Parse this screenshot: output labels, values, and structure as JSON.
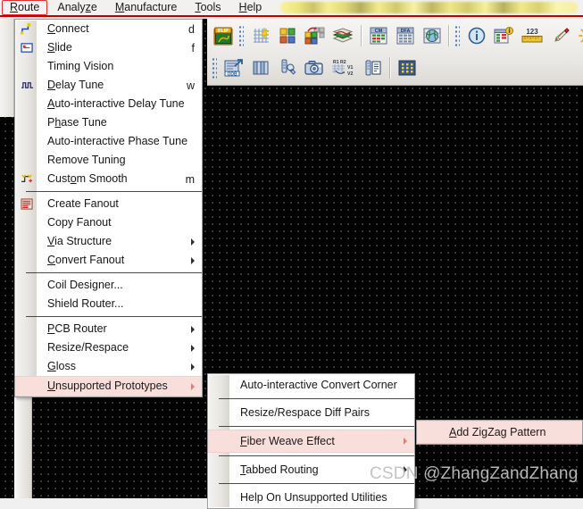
{
  "app": {
    "canvas_bg": "#000000",
    "accent_red": "#c00000",
    "highlight_pink": "#f9dfdc"
  },
  "menubar": {
    "items": [
      {
        "label": "Route",
        "mnemonic": "R",
        "selected": true
      },
      {
        "label": "Analyze",
        "mnemonic": "z",
        "selected": false
      },
      {
        "label": "Manufacture",
        "mnemonic": "M",
        "selected": false
      },
      {
        "label": "Tools",
        "mnemonic": "T",
        "selected": false
      },
      {
        "label": "Help",
        "mnemonic": "H",
        "selected": false
      }
    ],
    "censored_region": "redacted-yellow-highlight"
  },
  "toolbar": {
    "row1": [
      {
        "name": "flip-design-icon",
        "label": "FLIP"
      },
      {
        "name": "grid-sparkle-icon",
        "label": ""
      },
      {
        "name": "color-squares-icon",
        "label": ""
      },
      {
        "name": "color-squares-move-icon",
        "label": ""
      },
      {
        "name": "stackup-layers-icon",
        "label": ""
      },
      {
        "name": "cm-table-icon",
        "label": "CM"
      },
      {
        "name": "dfa-table-icon",
        "label": "DFA"
      },
      {
        "name": "globe-table-icon",
        "label": ""
      },
      {
        "name": "info-icon",
        "label": "i"
      },
      {
        "name": "table-info-badge-icon",
        "label": ""
      },
      {
        "name": "measure-ruler-icon",
        "label": "123"
      },
      {
        "name": "highlighter-pencil-icon",
        "label": ""
      },
      {
        "name": "sun-brightness-icon",
        "label": ""
      }
    ],
    "row2": [
      {
        "name": "odb-export-icon",
        "label": "ODB"
      },
      {
        "name": "layer-stack-icon",
        "label": ""
      },
      {
        "name": "wrench-tool-icon",
        "label": ""
      },
      {
        "name": "camera-snapshot-icon",
        "label": ""
      },
      {
        "name": "via-rule-icon",
        "label": "R1 R2 V1 V2"
      },
      {
        "name": "report-document-icon",
        "label": ""
      },
      {
        "name": "dot-matrix-icon",
        "label": ""
      }
    ]
  },
  "route_menu": {
    "items": [
      {
        "label": "Connect",
        "mnemonic": "C",
        "shortcut": "d",
        "icon": "connect-trace-icon",
        "arrow": false,
        "highlight": false
      },
      {
        "label": "Slide",
        "mnemonic": "S",
        "shortcut": "f",
        "icon": "slide-shape-icon",
        "arrow": false,
        "highlight": false
      },
      {
        "label": "Timing Vision",
        "mnemonic": "",
        "shortcut": "",
        "icon": "",
        "arrow": false,
        "highlight": false
      },
      {
        "label": "Delay Tune",
        "mnemonic": "D",
        "shortcut": "w",
        "icon": "delay-tune-icon",
        "arrow": false,
        "highlight": false
      },
      {
        "label": "Auto-interactive Delay Tune",
        "mnemonic": "A",
        "shortcut": "",
        "icon": "",
        "arrow": false,
        "highlight": false
      },
      {
        "label": "Phase Tune",
        "mnemonic": "h",
        "shortcut": "",
        "icon": "",
        "arrow": false,
        "highlight": false
      },
      {
        "label": "Auto-interactive Phase Tune",
        "mnemonic": "",
        "shortcut": "",
        "icon": "",
        "arrow": false,
        "highlight": false
      },
      {
        "label": "Remove Tuning",
        "mnemonic": "",
        "shortcut": "",
        "icon": "",
        "arrow": false,
        "highlight": false
      },
      {
        "label": "Custom Smooth",
        "mnemonic": "o",
        "shortcut": "m",
        "icon": "custom-smooth-icon",
        "arrow": false,
        "highlight": false
      },
      {
        "separator": true
      },
      {
        "label": "Create Fanout",
        "mnemonic": "",
        "shortcut": "",
        "icon": "create-fanout-icon",
        "arrow": false,
        "highlight": false
      },
      {
        "label": "Copy Fanout",
        "mnemonic": "",
        "shortcut": "",
        "icon": "",
        "arrow": false,
        "highlight": false
      },
      {
        "label": "Via Structure",
        "mnemonic": "V",
        "shortcut": "",
        "icon": "",
        "arrow": true,
        "highlight": false
      },
      {
        "label": "Convert Fanout",
        "mnemonic": "C",
        "shortcut": "",
        "icon": "",
        "arrow": true,
        "highlight": false
      },
      {
        "separator": true
      },
      {
        "label": "Coil Designer...",
        "mnemonic": "",
        "shortcut": "",
        "icon": "",
        "arrow": false,
        "highlight": false
      },
      {
        "label": "Shield Router...",
        "mnemonic": "",
        "shortcut": "",
        "icon": "",
        "arrow": false,
        "highlight": false
      },
      {
        "separator": true
      },
      {
        "label": "PCB Router",
        "mnemonic": "P",
        "shortcut": "",
        "icon": "",
        "arrow": true,
        "highlight": false
      },
      {
        "label": "Resize/Respace",
        "mnemonic": "",
        "shortcut": "",
        "icon": "",
        "arrow": true,
        "highlight": false
      },
      {
        "label": "Gloss",
        "mnemonic": "G",
        "shortcut": "",
        "icon": "",
        "arrow": true,
        "highlight": false
      },
      {
        "label": "Unsupported Prototypes",
        "mnemonic": "U",
        "shortcut": "",
        "icon": "",
        "arrow": true,
        "highlight": true
      }
    ]
  },
  "unsupported_submenu": {
    "items": [
      {
        "label": "Auto-interactive Convert Corner",
        "mnemonic": "",
        "arrow": false,
        "highlight": false
      },
      {
        "label": "Resize/Respace Diff Pairs",
        "mnemonic": "",
        "arrow": false,
        "highlight": false
      },
      {
        "label": "Fiber Weave Effect",
        "mnemonic": "F",
        "arrow": true,
        "highlight": true
      },
      {
        "label": "Tabbed Routing",
        "mnemonic": "T",
        "arrow": true,
        "highlight": false
      },
      {
        "label": "Help On Unsupported Utilities",
        "mnemonic": "",
        "arrow": false,
        "highlight": false
      }
    ]
  },
  "fiber_weave_submenu": {
    "items": [
      {
        "label": "Add ZigZag Pattern",
        "mnemonic": "A",
        "arrow": false,
        "highlight": true
      }
    ]
  },
  "watermark": {
    "prefix": "CSDN",
    "handle": "@ZhangZandZhang"
  }
}
